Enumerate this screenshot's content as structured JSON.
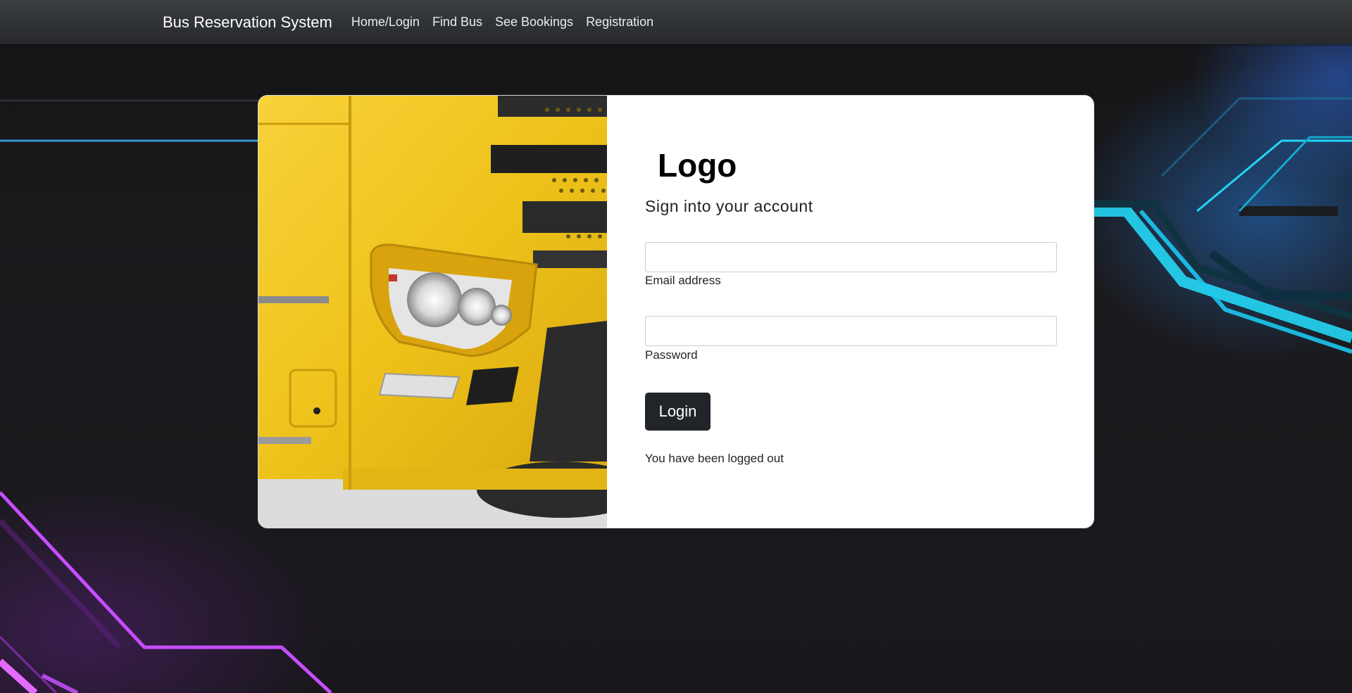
{
  "navbar": {
    "brand": "Bus Reservation System",
    "links": [
      "Home/Login",
      "Find Bus",
      "See Bookings",
      "Registration"
    ]
  },
  "login": {
    "logo": "Logo",
    "subtitle": "Sign into your account",
    "email_label": "Email address",
    "email_value": "",
    "password_label": "Password",
    "password_value": "",
    "button_label": "Login",
    "status_message": "You have been logged out"
  },
  "colors": {
    "navbar": "#2f3236",
    "button": "#212529",
    "bus_yellow": "#f2c21b"
  }
}
